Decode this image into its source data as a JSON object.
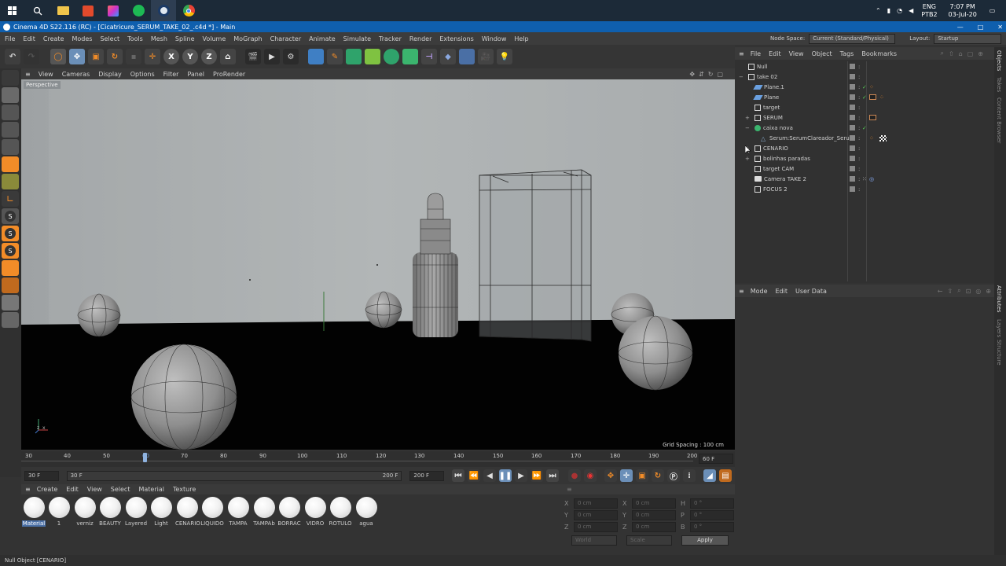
{
  "taskbar": {
    "lang": "ENG",
    "layout": "PTB2",
    "time": "7:07 PM",
    "date": "03-Jul-20"
  },
  "window": {
    "title": "Cinema 4D S22.116 (RC) - [Cicatricure_SERUM_TAKE_02_.c4d *] - Main"
  },
  "menu": [
    "File",
    "Edit",
    "Create",
    "Modes",
    "Select",
    "Tools",
    "Mesh",
    "Spline",
    "Volume",
    "MoGraph",
    "Character",
    "Animate",
    "Simulate",
    "Tracker",
    "Render",
    "Extensions",
    "Window",
    "Help"
  ],
  "nodespace": {
    "label": "Node Space:",
    "value": "Current (Standard/Physical)",
    "layout_label": "Layout:",
    "layout_value": "Startup"
  },
  "toolbar": {
    "axis_x": "X",
    "axis_y": "Y",
    "axis_z": "Z"
  },
  "viewport": {
    "menu": [
      "View",
      "Cameras",
      "Display",
      "Options",
      "Filter",
      "Panel",
      "ProRender"
    ],
    "label": "Perspective",
    "grid_spacing": "Grid Spacing : 100 cm"
  },
  "timeline": {
    "ticks": [
      "30",
      "40",
      "50",
      "60",
      "70",
      "80",
      "90",
      "100",
      "110",
      "120",
      "130",
      "140",
      "150",
      "160",
      "170",
      "180",
      "190",
      "200"
    ],
    "current_frame": "60 F"
  },
  "transport": {
    "start": "30 F",
    "range_start": "30 F",
    "range_end": "200 F",
    "end": "200 F"
  },
  "material_manager": {
    "menu": [
      "Create",
      "Edit",
      "View",
      "Select",
      "Material",
      "Texture"
    ],
    "materials": [
      "Material",
      "1",
      "verniz",
      "BEAUTY",
      "Layered",
      "Light",
      "CENARIO",
      "LIQUIDO",
      "TAMPA",
      "TAMPAb",
      "BORRAC",
      "VIDRO",
      "ROTULO",
      "agua"
    ]
  },
  "coordinates": {
    "rows": [
      {
        "a": "X",
        "av": "0 cm",
        "b": "X",
        "bv": "0 cm",
        "c": "H",
        "cv": "0 °"
      },
      {
        "a": "Y",
        "av": "0 cm",
        "b": "Y",
        "bv": "0 cm",
        "c": "P",
        "cv": "0 °"
      },
      {
        "a": "Z",
        "av": "0 cm",
        "b": "Z",
        "bv": "0 cm",
        "c": "B",
        "cv": "0 °"
      }
    ],
    "world": "World",
    "scale": "Scale",
    "apply": "Apply"
  },
  "object_manager": {
    "menu": [
      "File",
      "Edit",
      "View",
      "Object",
      "Tags",
      "Bookmarks"
    ],
    "objects": [
      {
        "name": "Null",
        "indent": 0,
        "expand": "",
        "icon": "null"
      },
      {
        "name": "take 02",
        "indent": 0,
        "expand": "−",
        "icon": "null"
      },
      {
        "name": "Plane.1",
        "indent": 1,
        "expand": "",
        "icon": "plane"
      },
      {
        "name": "Plane",
        "indent": 1,
        "expand": "",
        "icon": "plane"
      },
      {
        "name": "target",
        "indent": 1,
        "expand": "",
        "icon": "null"
      },
      {
        "name": "SERUM",
        "indent": 1,
        "expand": "+",
        "icon": "null"
      },
      {
        "name": "caixa nova",
        "indent": 1,
        "expand": "−",
        "icon": "green"
      },
      {
        "name": "Serum:SerumClareador_Serum",
        "indent": 2,
        "expand": "",
        "icon": "mesh"
      },
      {
        "name": "CENARIO",
        "indent": 1,
        "expand": "+",
        "icon": "null"
      },
      {
        "name": "bolinhas paradas",
        "indent": 1,
        "expand": "+",
        "icon": "null"
      },
      {
        "name": "target CAM",
        "indent": 1,
        "expand": "",
        "icon": "null"
      },
      {
        "name": "Camera TAKE 2",
        "indent": 1,
        "expand": "",
        "icon": "camera"
      },
      {
        "name": "FOCUS 2",
        "indent": 1,
        "expand": "",
        "icon": "null"
      }
    ]
  },
  "attributes": {
    "menu": [
      "Mode",
      "Edit",
      "User Data"
    ]
  },
  "side_tabs": [
    "Objects",
    "Takes",
    "Content Browser",
    "Attributes",
    "Layers",
    "Structure"
  ],
  "status": "Null Object [CENARIO]"
}
